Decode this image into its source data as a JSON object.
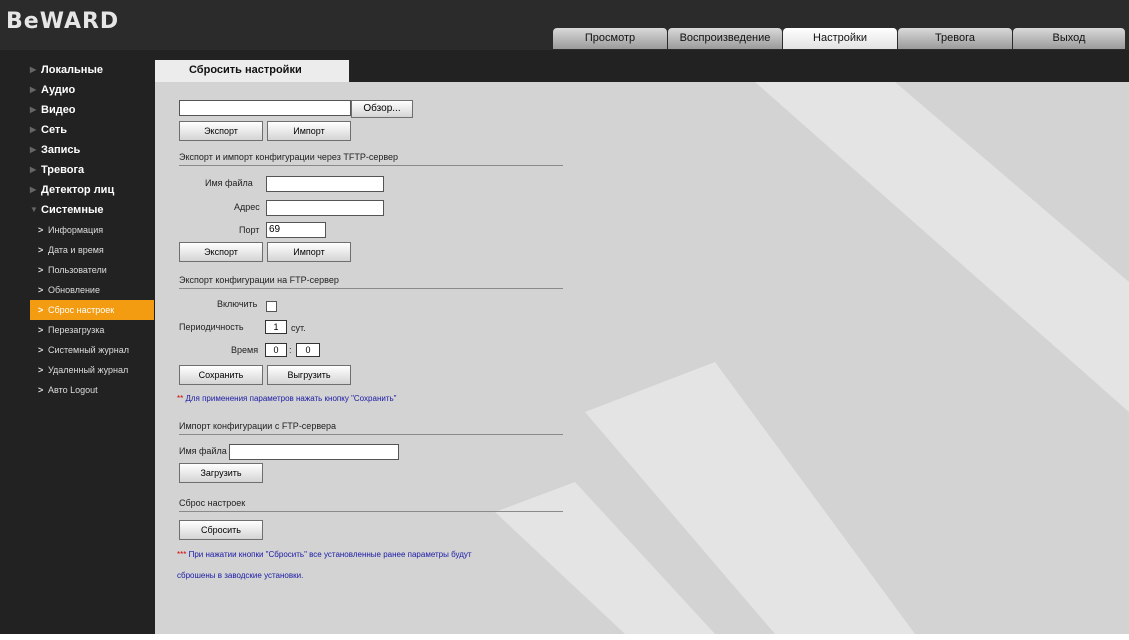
{
  "brand": {
    "logo_text": "BeWARD"
  },
  "nav_tabs": [
    {
      "label": "Просмотр"
    },
    {
      "label": "Воспроизведение"
    },
    {
      "label": "Настройки",
      "active": true
    },
    {
      "label": "Тревога"
    },
    {
      "label": "Выход"
    }
  ],
  "sidebar": {
    "items": [
      {
        "label": "Локальные"
      },
      {
        "label": "Аудио"
      },
      {
        "label": "Видео"
      },
      {
        "label": "Сеть"
      },
      {
        "label": "Запись"
      },
      {
        "label": "Тревога"
      },
      {
        "label": "Детектор лиц"
      },
      {
        "label": "Системные",
        "expanded": true
      }
    ],
    "sub_items": [
      {
        "label": "Информация"
      },
      {
        "label": "Дата и время"
      },
      {
        "label": "Пользователи"
      },
      {
        "label": "Обновление"
      },
      {
        "label": "Сброс настроек",
        "active": true
      },
      {
        "label": "Перезагрузка"
      },
      {
        "label": "Системный журнал"
      },
      {
        "label": "Удаленный журнал"
      },
      {
        "label": "Авто Logout"
      }
    ]
  },
  "page_tab": {
    "title": "Сбросить настройки"
  },
  "local": {
    "file_value": "",
    "browse_label": "Обзор...",
    "export_label": "Экспорт",
    "import_label": "Импорт"
  },
  "tftp": {
    "title": "Экспорт и импорт конфигурации через TFTP-сервер",
    "filename_label": "Имя файла",
    "filename_value": "",
    "address_label": "Адрес",
    "address_value": "",
    "port_label": "Порт",
    "port_value": "69",
    "export_label": "Экспорт",
    "import_label": "Импорт"
  },
  "ftp_export": {
    "title": "Экспорт конфигурации на FTP-сервер",
    "enable_label": "Включить",
    "enabled": false,
    "period_label": "Периодичность",
    "period_value": "1",
    "period_unit": "сут.",
    "time_label": "Время",
    "time_hours": "0",
    "time_sep": ":",
    "time_minutes": "0",
    "save_label": "Сохранить",
    "upload_label": "Выгрузить",
    "note_stars": "**",
    "note_text": " Для применения параметров нажать кнопку \"Сохранить\""
  },
  "ftp_import": {
    "title": "Импорт конфигурации с FTP-сервера",
    "filename_label": "Имя файла",
    "filename_value": "",
    "load_label": "Загрузить"
  },
  "reset": {
    "title": "Сброс настроек",
    "reset_label": "Сбросить",
    "note_stars": "***",
    "note_line1": " При нажатии кнопки \"Сбросить\" все установленные ранее параметры будут",
    "note_line2": "сброшены в заводские установки."
  },
  "colors": {
    "accent": "#f39c12",
    "note_text": "#1a1aa6",
    "note_star": "#d40000",
    "content_bg": "#d3d3d3",
    "frame_bg": "#222222"
  }
}
